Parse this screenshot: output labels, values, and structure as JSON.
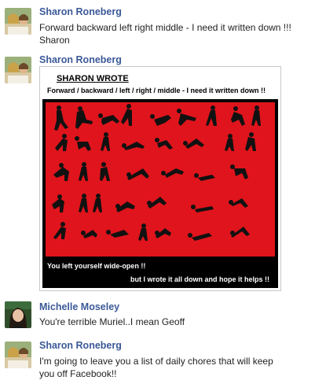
{
  "posts": [
    {
      "author": "Sharon Roneberg",
      "message_line1": "Forward backward left right middle - I need it written down !!!",
      "message_line2": "Sharon"
    },
    {
      "author": "Sharon Roneberg",
      "image": {
        "title": "SHARON WROTE",
        "subtitle": "Forward / backward / left / right / middle - I need it written down !!",
        "caption1": "You left yourself wide-open !!",
        "caption2": "but I wrote it all down and hope it helps !!"
      }
    },
    {
      "author": "Michelle Moseley",
      "message_line1": "You're terrible Muriel..I mean Geoff"
    },
    {
      "author": "Sharon Roneberg",
      "message_line1": "I'm going to leave you a list of daily chores that will keep",
      "message_line2": "you off Facebook!!"
    }
  ],
  "colors": {
    "author_link": "#3b5998",
    "poster_red": "#e0141c"
  },
  "icons": [
    "avatar-sharon",
    "avatar-michelle"
  ]
}
